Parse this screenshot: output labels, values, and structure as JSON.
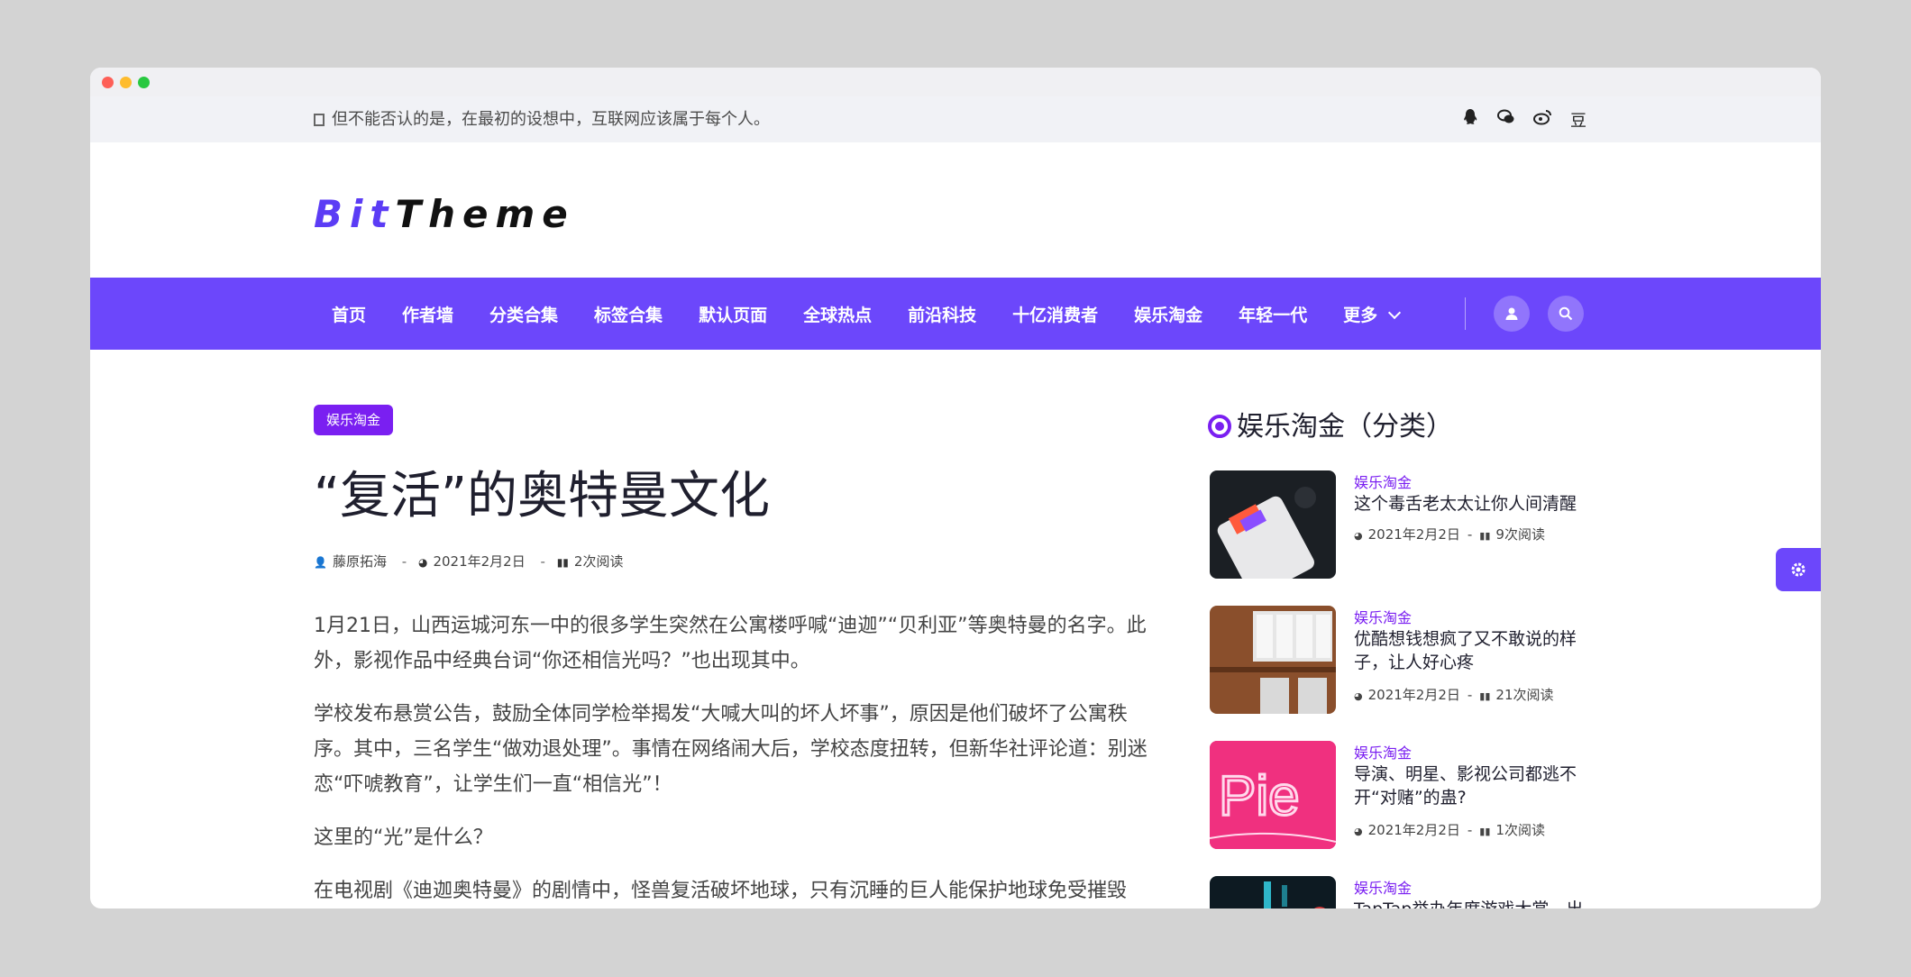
{
  "topbar": {
    "notice": "但不能否认的是，在最初的设想中，互联网应该属于每个人。",
    "social_icons": [
      "qq-icon",
      "wechat-icon",
      "weibo-icon",
      "douban-icon"
    ],
    "douban_glyph": "豆"
  },
  "logo": {
    "part1": "Bit",
    "part2": "Theme"
  },
  "nav": {
    "items": [
      "首页",
      "作者墙",
      "分类合集",
      "标签合集",
      "默认页面",
      "全球热点",
      "前沿科技",
      "十亿消费者",
      "娱乐淘金",
      "年轻一代"
    ],
    "more": "更多"
  },
  "article": {
    "category": "娱乐淘金",
    "title": "“复活”的奥特曼文化",
    "author": "藤原拓海",
    "date": "2021年2月2日",
    "reads": "2次阅读",
    "paragraphs": [
      "1月21日，山西运城河东一中的很多学生突然在公寓楼呼喊“迪迦”“贝利亚”等奥特曼的名字。此外，影视作品中经典台词“你还相信光吗？”也出现其中。",
      "学校发布悬赏公告，鼓励全体同学检举揭发“大喊大叫的坏人坏事”，原因是他们破坏了公寓秩序。其中，三名学生“做劝退处理”。事情在网络闹大后，学校态度扭转，但新华社评论道：别迷恋“吓唬教育”，让学生们一直“相信光”！",
      "这里的“光”是什么？",
      "在电视剧《迪迦奥特曼》的剧情中，怪兽复活破坏地球，只有沉睡的巨人能保护地球免受摧毁"
    ]
  },
  "sidebar": {
    "title": "娱乐淘金（分类）",
    "items": [
      {
        "category": "娱乐淘金",
        "title": "这个毒舌老太太让你人间清醒",
        "date": "2021年2月2日",
        "reads": "9次阅读"
      },
      {
        "category": "娱乐淘金",
        "title": "优酷想钱想疯了又不敢说的样子，让人好心疼",
        "date": "2021年2月2日",
        "reads": "21次阅读"
      },
      {
        "category": "娱乐淘金",
        "title": "导演、明星、影视公司都逃不开“对赌”的蛊?",
        "date": "2021年2月2日",
        "reads": "1次阅读"
      },
      {
        "category": "娱乐淘金",
        "title": "TapTap举办年度游戏大赏，出",
        "date": "",
        "reads": ""
      }
    ],
    "thumb3_text": "Pie"
  },
  "colors": {
    "accent": "#6c47fb",
    "badge": "#7a1ff1"
  }
}
